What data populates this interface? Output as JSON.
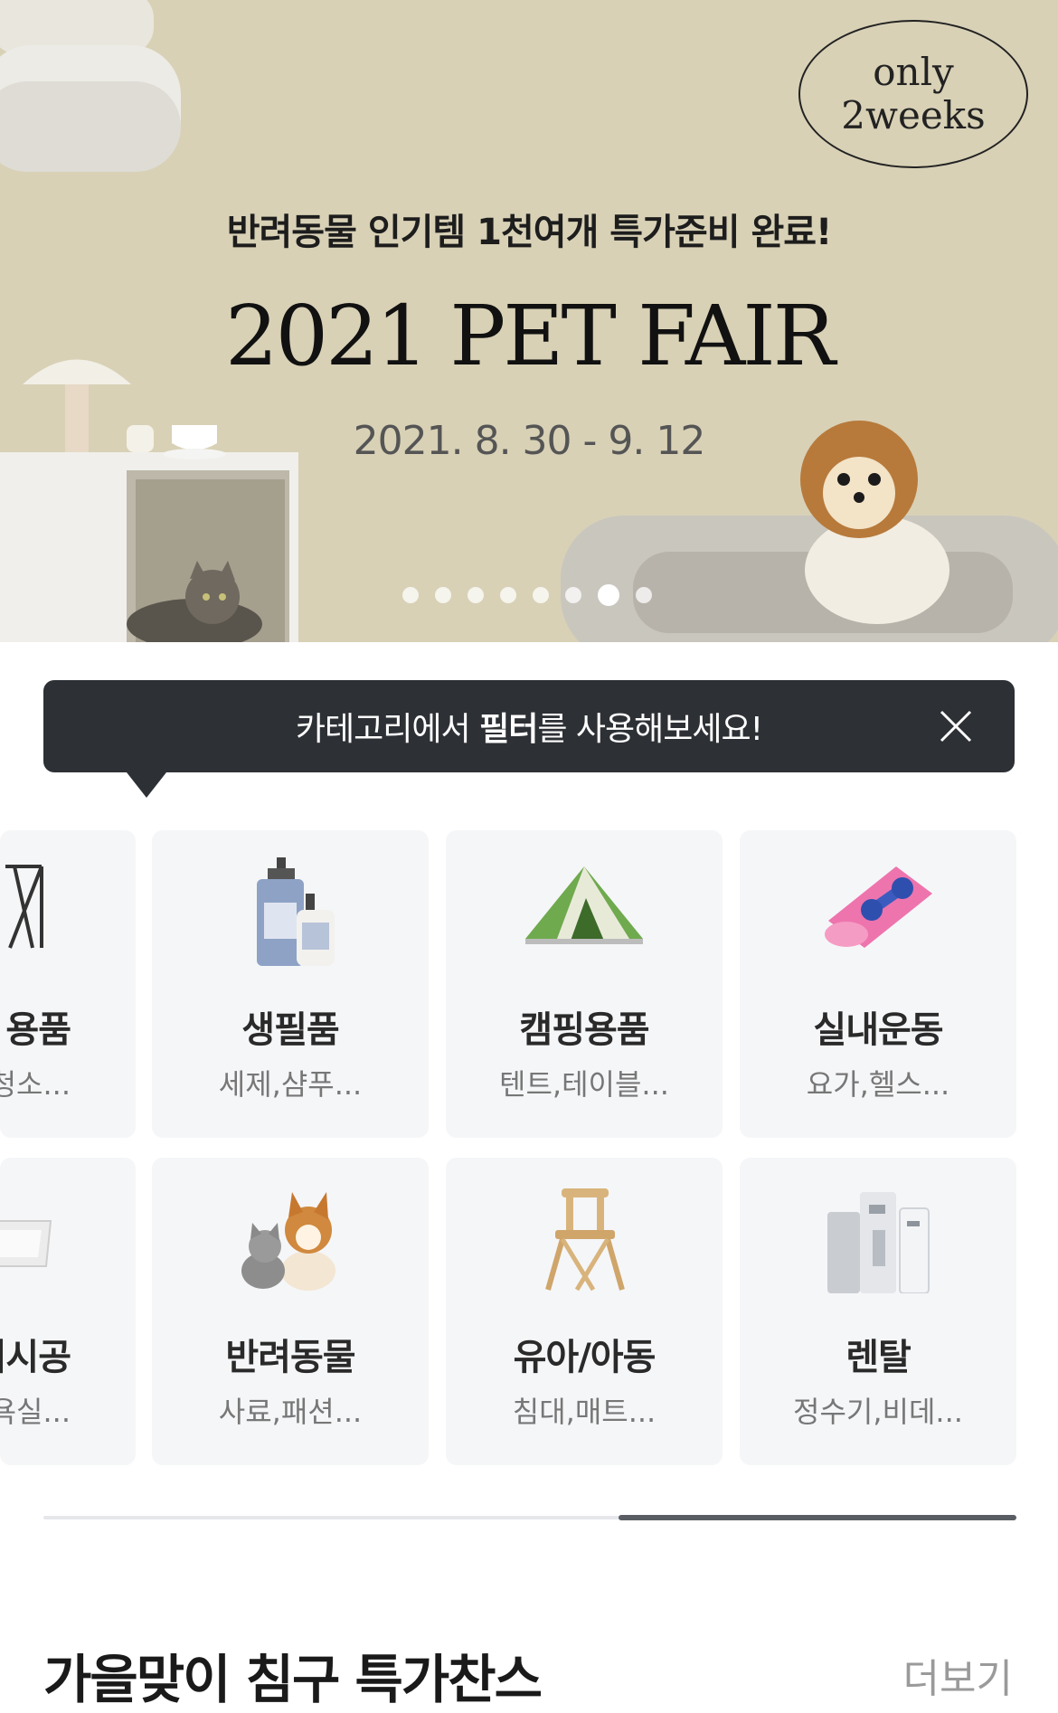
{
  "banner": {
    "badge_line1": "only",
    "badge_line2": "2weeks",
    "headline": "반려동물 인기템 1천여개 특가준비 완료!",
    "title": "2021 PET FAIR",
    "dates": "2021. 8. 30 - 9. 12",
    "pagination": {
      "total": 8,
      "active": 7
    }
  },
  "tooltip": {
    "text_before": "카테고리에서 ",
    "text_bold": "필터",
    "text_after": "를 사용해보세요!",
    "close_icon": "close-icon"
  },
  "categories": [
    {
      "name": "용품",
      "sub": "청소...",
      "icon": "drying-rack-icon"
    },
    {
      "name": "생필품",
      "sub": "세제,샴푸...",
      "icon": "shampoo-bottles-icon"
    },
    {
      "name": "캠핑용품",
      "sub": "텐트,테이블...",
      "icon": "tent-icon"
    },
    {
      "name": "실내운동",
      "sub": "요가,헬스...",
      "icon": "yoga-mat-dumbbell-icon"
    },
    {
      "name": "어시공",
      "sub": "욕실...",
      "icon": "bathtub-icon"
    },
    {
      "name": "반려동물",
      "sub": "사료,패션...",
      "icon": "puppy-kitten-icon"
    },
    {
      "name": "유아/아동",
      "sub": "침대,매트...",
      "icon": "high-chair-icon"
    },
    {
      "name": "렌탈",
      "sub": "정수기,비데...",
      "icon": "water-purifier-icon"
    }
  ],
  "section": {
    "title": "가을맞이 침구 특가찬스",
    "more": "더보기"
  },
  "colors": {
    "banner_bg": "#d8d1b6",
    "tooltip_bg": "#2d3035",
    "card_bg": "#f5f6f8"
  }
}
